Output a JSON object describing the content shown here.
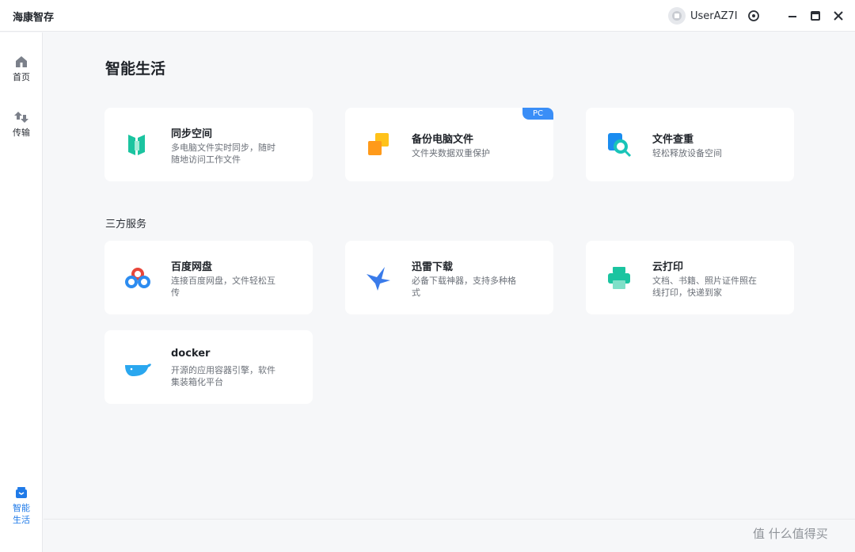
{
  "app": {
    "title": "海康智存"
  },
  "user": {
    "name": "UserAZ7I"
  },
  "sidebar": {
    "items": [
      {
        "label": "首页",
        "icon": "home-icon"
      },
      {
        "label": "传输",
        "icon": "transfer-icon"
      },
      {
        "label": "智能生活",
        "icon": "smart-life-icon",
        "active": true
      }
    ]
  },
  "main": {
    "title": "智能生活",
    "cards": [
      {
        "name": "同步空间",
        "desc": "多电脑文件实时同步，随时随地访问工作文件",
        "icon": "sync-space-icon"
      },
      {
        "name": "备份电脑文件",
        "desc": "文件夹数据双重保护",
        "icon": "backup-icon",
        "badge": "PC"
      },
      {
        "name": "文件查重",
        "desc": "轻松释放设备空间",
        "icon": "file-dedupe-icon"
      }
    ],
    "section_title": "三方服务",
    "services": [
      {
        "name": "百度网盘",
        "desc": "连接百度网盘，文件轻松互传",
        "icon": "baidu-netdisk-icon"
      },
      {
        "name": "迅雷下载",
        "desc": "必备下载神器，支持多种格式",
        "icon": "thunder-icon"
      },
      {
        "name": "云打印",
        "desc": "文档、书籍、照片证件照在线打印，快递到家",
        "icon": "printer-icon"
      },
      {
        "name": "docker",
        "desc": "开源的应用容器引擎，软件集装箱化平台",
        "icon": "docker-icon"
      }
    ]
  },
  "watermark": {
    "text": "值 什么值得买"
  },
  "colors": {
    "accent": "#1f7ae8",
    "badge": "#3a8ef7",
    "background": "#f6f7f9"
  }
}
